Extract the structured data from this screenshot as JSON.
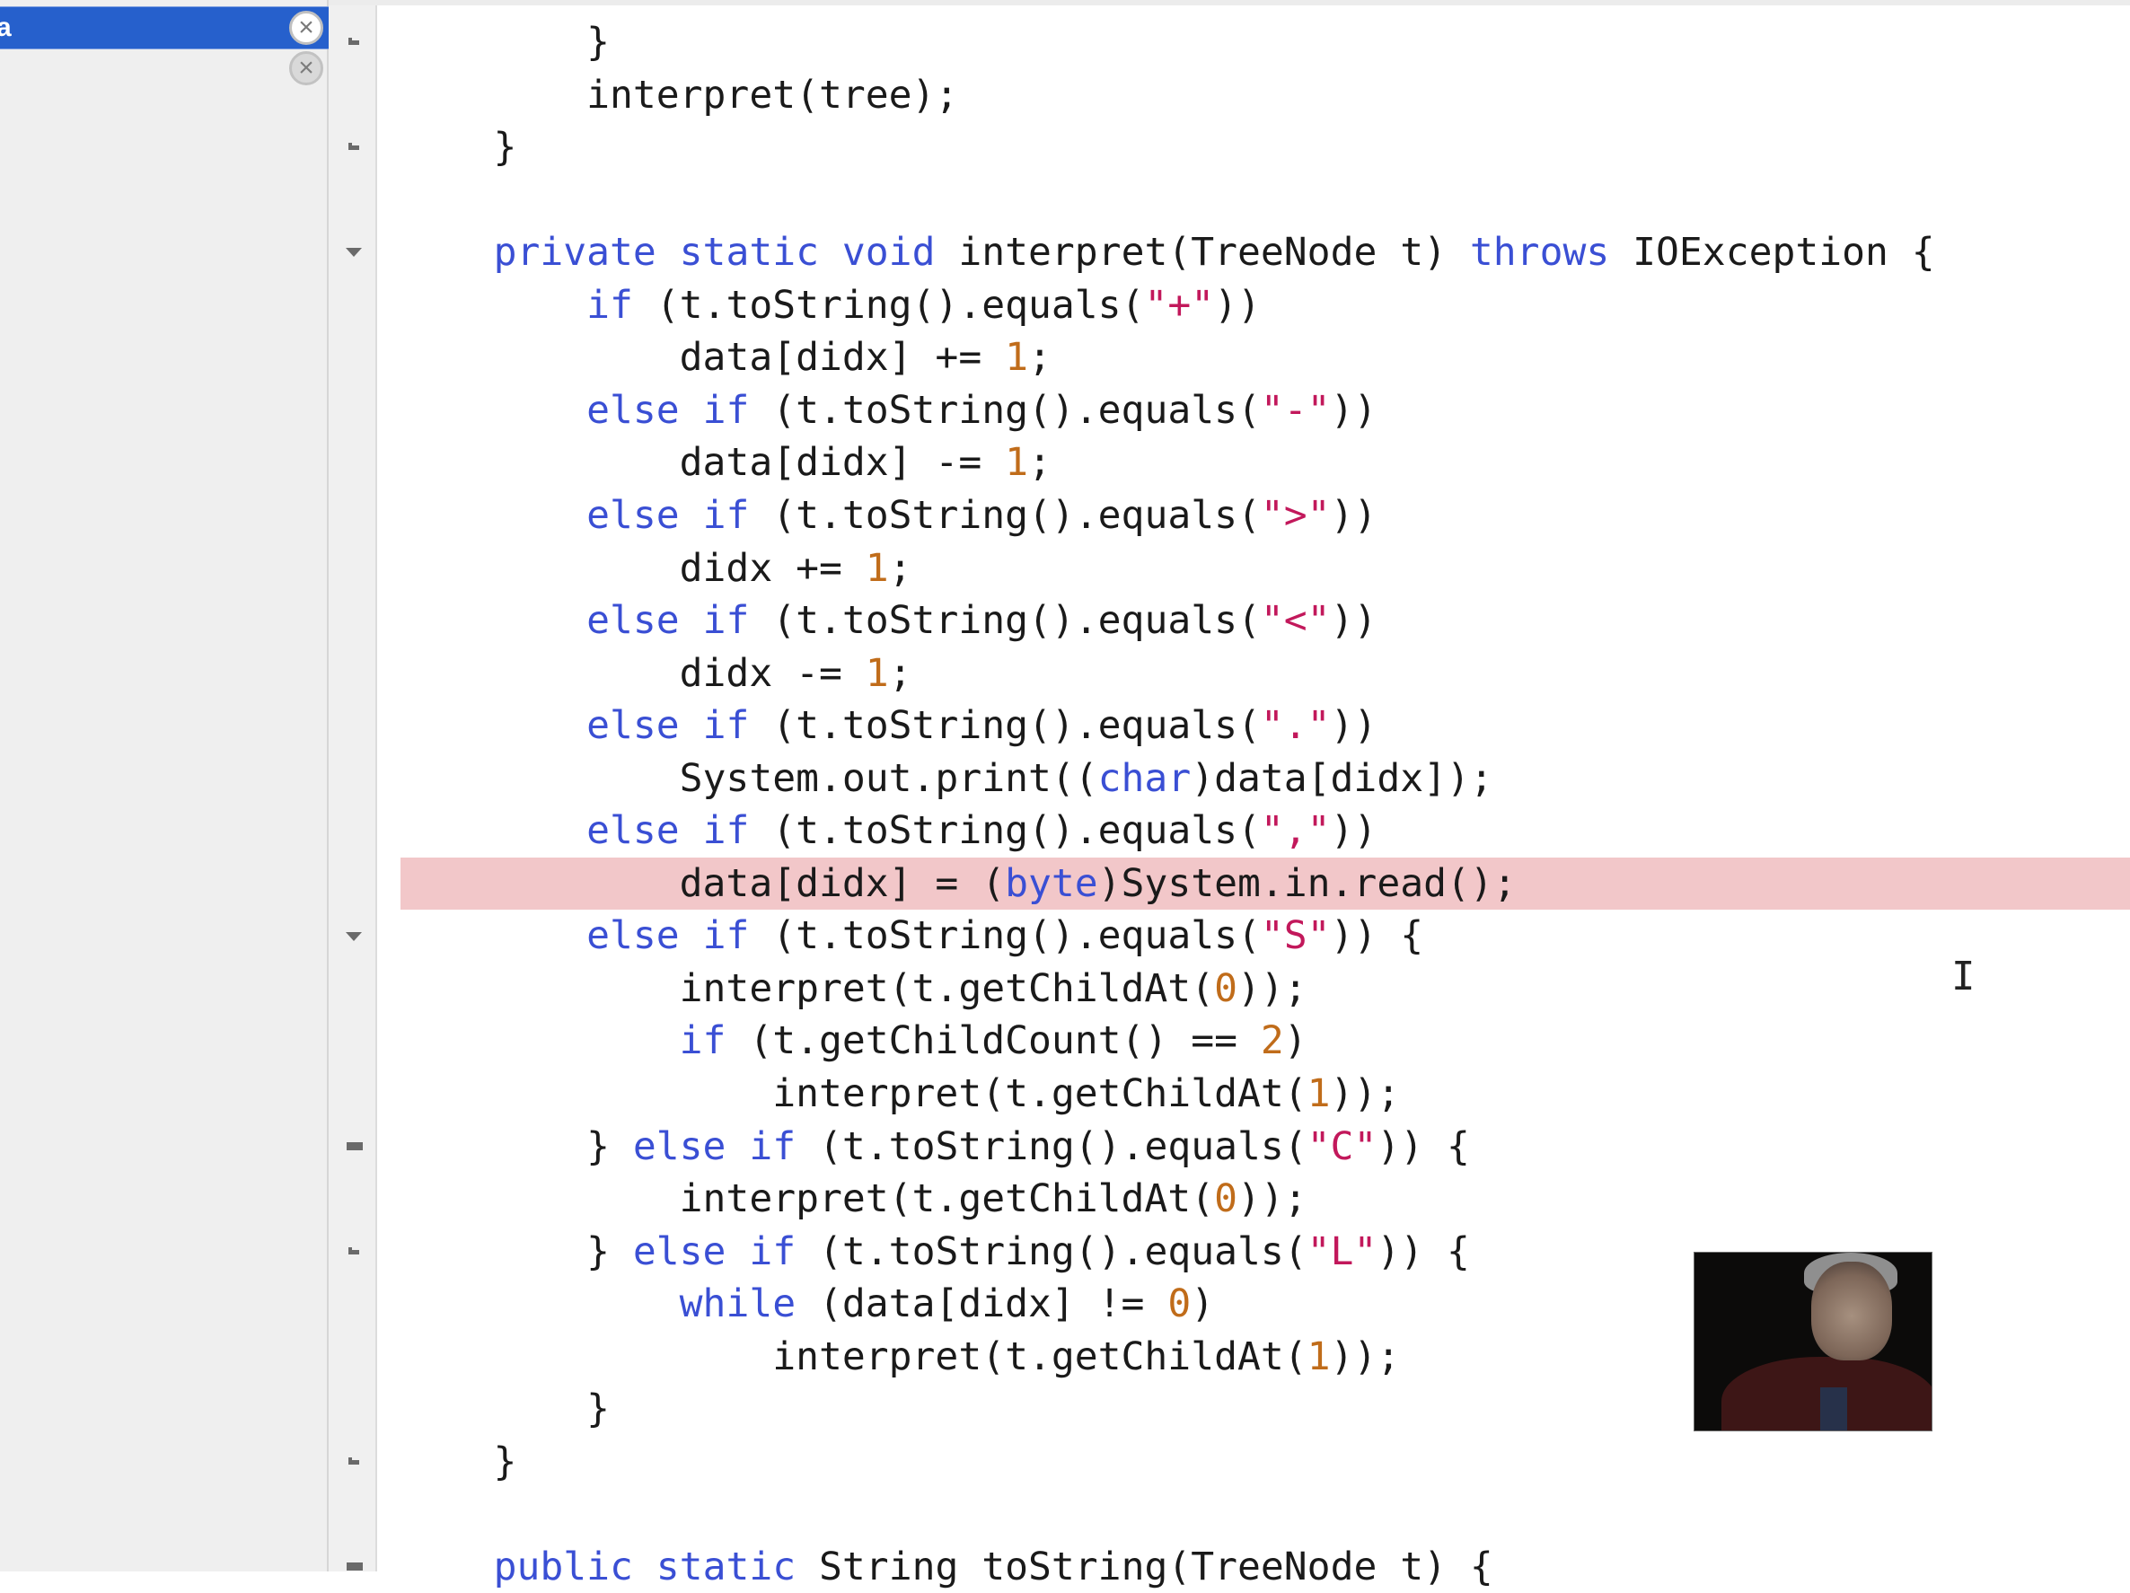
{
  "sidebar": {
    "files": [
      {
        "label": "a",
        "selected": true,
        "close_icon": "close-circle-icon"
      },
      {
        "label": "",
        "selected": false,
        "close_icon": "close-circle-icon"
      }
    ]
  },
  "editor": {
    "language": "Java",
    "highlighted_line_index": 16,
    "lines": [
      [
        {
          "t": "        }"
        }
      ],
      [
        {
          "t": "        interpret(tree);"
        }
      ],
      [
        {
          "t": "    }"
        }
      ],
      [
        {
          "t": ""
        }
      ],
      [
        {
          "t": "    "
        },
        {
          "t": "private",
          "c": "kw"
        },
        {
          "t": " "
        },
        {
          "t": "static",
          "c": "kw"
        },
        {
          "t": " "
        },
        {
          "t": "void",
          "c": "kw"
        },
        {
          "t": " interpret(TreeNode t) "
        },
        {
          "t": "throws",
          "c": "kw"
        },
        {
          "t": " IOException {"
        }
      ],
      [
        {
          "t": "        "
        },
        {
          "t": "if",
          "c": "kw"
        },
        {
          "t": " (t.toString().equals("
        },
        {
          "t": "\"+\"",
          "c": "str"
        },
        {
          "t": "))"
        }
      ],
      [
        {
          "t": "            data[didx] += "
        },
        {
          "t": "1",
          "c": "num"
        },
        {
          "t": ";"
        }
      ],
      [
        {
          "t": "        "
        },
        {
          "t": "else",
          "c": "kw"
        },
        {
          "t": " "
        },
        {
          "t": "if",
          "c": "kw"
        },
        {
          "t": " (t.toString().equals("
        },
        {
          "t": "\"-\"",
          "c": "str"
        },
        {
          "t": "))"
        }
      ],
      [
        {
          "t": "            data[didx] -= "
        },
        {
          "t": "1",
          "c": "num"
        },
        {
          "t": ";"
        }
      ],
      [
        {
          "t": "        "
        },
        {
          "t": "else",
          "c": "kw"
        },
        {
          "t": " "
        },
        {
          "t": "if",
          "c": "kw"
        },
        {
          "t": " (t.toString().equals("
        },
        {
          "t": "\">\"",
          "c": "str"
        },
        {
          "t": "))"
        }
      ],
      [
        {
          "t": "            didx += "
        },
        {
          "t": "1",
          "c": "num"
        },
        {
          "t": ";"
        }
      ],
      [
        {
          "t": "        "
        },
        {
          "t": "else",
          "c": "kw"
        },
        {
          "t": " "
        },
        {
          "t": "if",
          "c": "kw"
        },
        {
          "t": " (t.toString().equals("
        },
        {
          "t": "\"<\"",
          "c": "str"
        },
        {
          "t": "))"
        }
      ],
      [
        {
          "t": "            didx -= "
        },
        {
          "t": "1",
          "c": "num"
        },
        {
          "t": ";"
        }
      ],
      [
        {
          "t": "        "
        },
        {
          "t": "else",
          "c": "kw"
        },
        {
          "t": " "
        },
        {
          "t": "if",
          "c": "kw"
        },
        {
          "t": " (t.toString().equals("
        },
        {
          "t": "\".\"",
          "c": "str"
        },
        {
          "t": "))"
        }
      ],
      [
        {
          "t": "            System.out.print(("
        },
        {
          "t": "char",
          "c": "kw"
        },
        {
          "t": ")data[didx]);"
        }
      ],
      [
        {
          "t": "        "
        },
        {
          "t": "else",
          "c": "kw"
        },
        {
          "t": " "
        },
        {
          "t": "if",
          "c": "kw"
        },
        {
          "t": " (t.toString().equals("
        },
        {
          "t": "\",\"",
          "c": "str"
        },
        {
          "t": "))"
        }
      ],
      [
        {
          "t": "            data[didx] = ("
        },
        {
          "t": "byte",
          "c": "kw"
        },
        {
          "t": ")System.in.read();"
        }
      ],
      [
        {
          "t": "        "
        },
        {
          "t": "else",
          "c": "kw"
        },
        {
          "t": " "
        },
        {
          "t": "if",
          "c": "kw"
        },
        {
          "t": " (t.toString().equals("
        },
        {
          "t": "\"S\"",
          "c": "str"
        },
        {
          "t": ")) {"
        }
      ],
      [
        {
          "t": "            interpret(t.getChildAt("
        },
        {
          "t": "0",
          "c": "num"
        },
        {
          "t": "));"
        }
      ],
      [
        {
          "t": "            "
        },
        {
          "t": "if",
          "c": "kw"
        },
        {
          "t": " (t.getChildCount() == "
        },
        {
          "t": "2",
          "c": "num"
        },
        {
          "t": ")"
        }
      ],
      [
        {
          "t": "                interpret(t.getChildAt("
        },
        {
          "t": "1",
          "c": "num"
        },
        {
          "t": "));"
        }
      ],
      [
        {
          "t": "        } "
        },
        {
          "t": "else",
          "c": "kw"
        },
        {
          "t": " "
        },
        {
          "t": "if",
          "c": "kw"
        },
        {
          "t": " (t.toString().equals("
        },
        {
          "t": "\"C\"",
          "c": "str"
        },
        {
          "t": ")) {"
        }
      ],
      [
        {
          "t": "            interpret(t.getChildAt("
        },
        {
          "t": "0",
          "c": "num"
        },
        {
          "t": "));"
        }
      ],
      [
        {
          "t": "        } "
        },
        {
          "t": "else",
          "c": "kw"
        },
        {
          "t": " "
        },
        {
          "t": "if",
          "c": "kw"
        },
        {
          "t": " (t.toString().equals("
        },
        {
          "t": "\"L\"",
          "c": "str"
        },
        {
          "t": ")) {"
        }
      ],
      [
        {
          "t": "            "
        },
        {
          "t": "while",
          "c": "kw"
        },
        {
          "t": " (data[didx] != "
        },
        {
          "t": "0",
          "c": "num"
        },
        {
          "t": ")"
        }
      ],
      [
        {
          "t": "                interpret(t.getChildAt("
        },
        {
          "t": "1",
          "c": "num"
        },
        {
          "t": "));"
        }
      ],
      [
        {
          "t": "        }"
        }
      ],
      [
        {
          "t": "    }"
        }
      ],
      [
        {
          "t": ""
        }
      ],
      [
        {
          "t": "    "
        },
        {
          "t": "public",
          "c": "kw"
        },
        {
          "t": " "
        },
        {
          "t": "static",
          "c": "kw"
        },
        {
          "t": " String toString(TreeNode t) {"
        }
      ]
    ],
    "gutter_markers": [
      {
        "line": 0,
        "type": "fold-end"
      },
      {
        "line": 2,
        "type": "fold-end"
      },
      {
        "line": 4,
        "type": "fold-open"
      },
      {
        "line": 17,
        "type": "fold-open"
      },
      {
        "line": 21,
        "type": "fold-mid"
      },
      {
        "line": 23,
        "type": "fold-end"
      },
      {
        "line": 27,
        "type": "fold-end"
      },
      {
        "line": 29,
        "type": "fold-mid"
      }
    ]
  },
  "video_overlay": {
    "description": "presenter webcam"
  },
  "cursor": {
    "type": "text-cursor",
    "glyph": "I"
  }
}
